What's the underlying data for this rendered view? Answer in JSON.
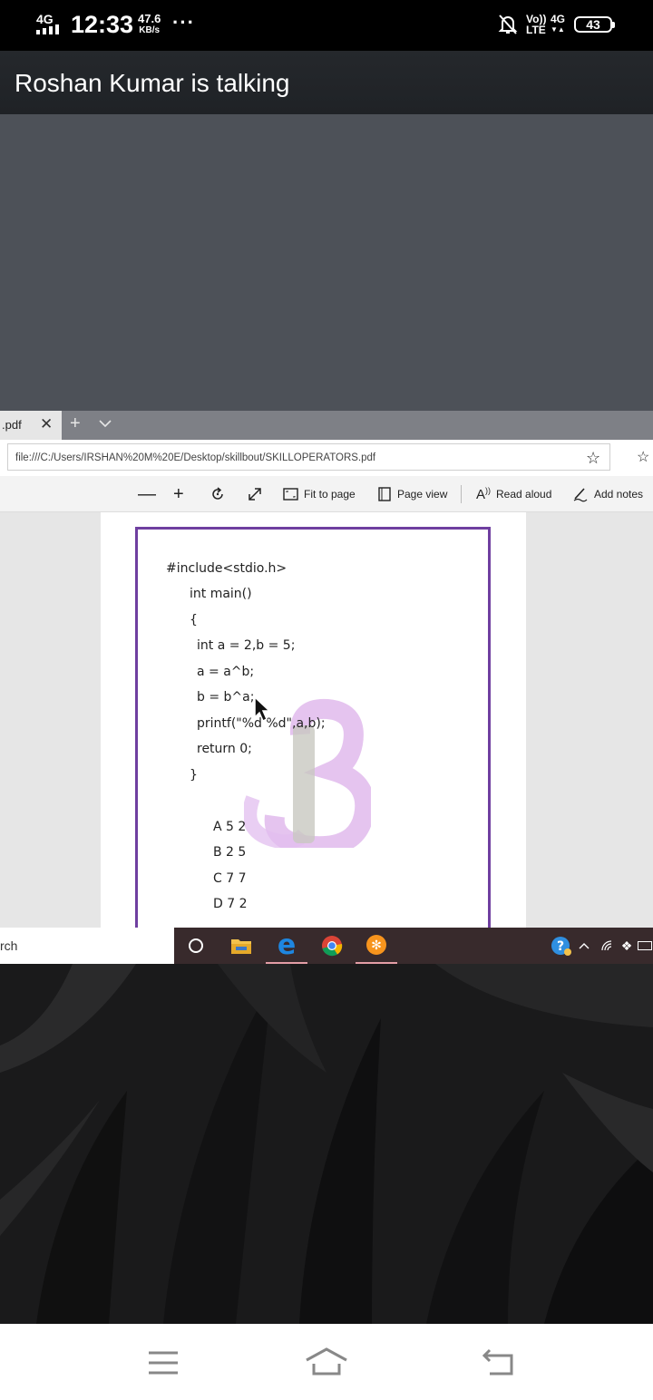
{
  "status_bar": {
    "network": "4G",
    "time": "12:33",
    "speed_value": "47.6",
    "speed_unit": "KB/s",
    "more": "···",
    "volte": "Vo))",
    "lte": "LTE",
    "net2": "4G",
    "battery": "43"
  },
  "call": {
    "title": "Roshan Kumar is talking"
  },
  "browser": {
    "tab_label": ".pdf",
    "url": "file:///C:/Users/IRSHAN%20M%20E/Desktop/skillbout/SKILLOPERATORS.pdf",
    "toolbar": {
      "fit_to_page": "Fit to page",
      "page_view": "Page view",
      "read_aloud": "Read aloud",
      "add_notes": "Add notes"
    }
  },
  "pdf": {
    "lines": [
      "#include<stdio.h>",
      "int main()",
      "{",
      "int a = 2,b = 5;",
      "a = a^b;",
      "b = b^a;",
      "printf(\"%d %d\",a,b);",
      "return 0;",
      "}"
    ],
    "options": [
      "A 5 2",
      "B 2 5",
      "C 7 7",
      "D 7 2"
    ]
  },
  "taskbar": {
    "search_text": "rch"
  },
  "colors": {
    "frame": "#6f3fa0",
    "watermark": "#d9a6e6",
    "call_bar": "#222529"
  }
}
